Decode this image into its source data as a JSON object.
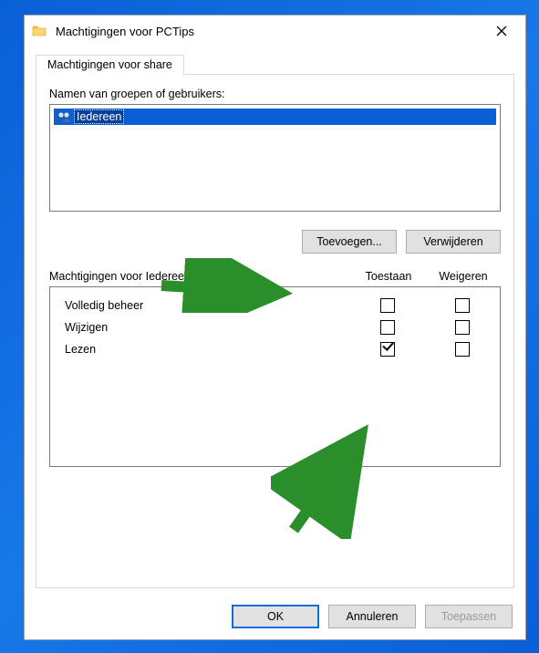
{
  "window": {
    "title": "Machtigingen voor PCTips"
  },
  "tab": {
    "label": "Machtigingen voor share"
  },
  "users": {
    "label": "Namen van groepen of gebruikers:",
    "items": [
      "Iedereen"
    ]
  },
  "buttons": {
    "add": "Toevoegen...",
    "remove": "Verwijderen",
    "ok": "OK",
    "cancel": "Annuleren",
    "apply": "Toepassen"
  },
  "permissions": {
    "header_label": "Machtigingen voor Iedereen",
    "col_allow": "Toestaan",
    "col_deny": "Weigeren",
    "rows": [
      {
        "label": "Volledig beheer",
        "allow": false,
        "deny": false
      },
      {
        "label": "Wijzigen",
        "allow": false,
        "deny": false
      },
      {
        "label": "Lezen",
        "allow": true,
        "deny": false
      }
    ]
  },
  "colors": {
    "accent": "#0a5fd6",
    "arrow": "#2a8f2a"
  }
}
